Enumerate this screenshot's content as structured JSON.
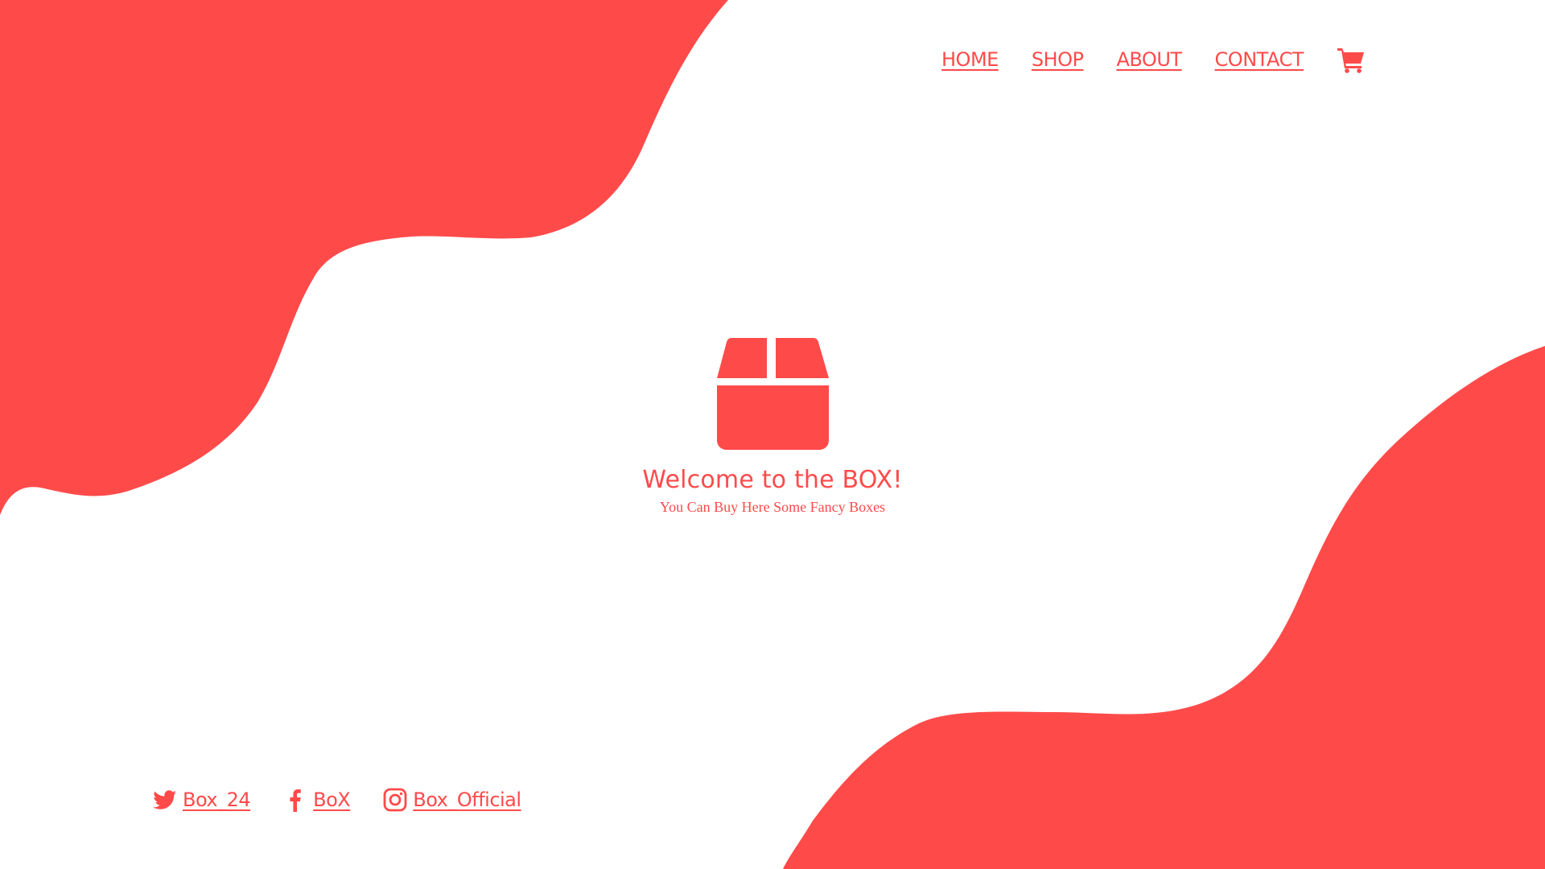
{
  "theme": {
    "accent": "#ff4a4a",
    "background": "#ffffff"
  },
  "nav": {
    "items": [
      {
        "label": "HOME"
      },
      {
        "label": "SHOP"
      },
      {
        "label": "ABOUT"
      },
      {
        "label": "CONTACT"
      }
    ],
    "cart_icon": "shopping-cart-icon"
  },
  "hero": {
    "icon": "box-icon",
    "title": "Welcome to the BOX!",
    "subtitle": "You Can Buy Here Some Fancy Boxes"
  },
  "social": {
    "items": [
      {
        "icon": "twitter-icon",
        "label": "Box_24"
      },
      {
        "icon": "facebook-icon",
        "label": "BoX"
      },
      {
        "icon": "instagram-icon",
        "label": "Box_Official"
      }
    ]
  }
}
